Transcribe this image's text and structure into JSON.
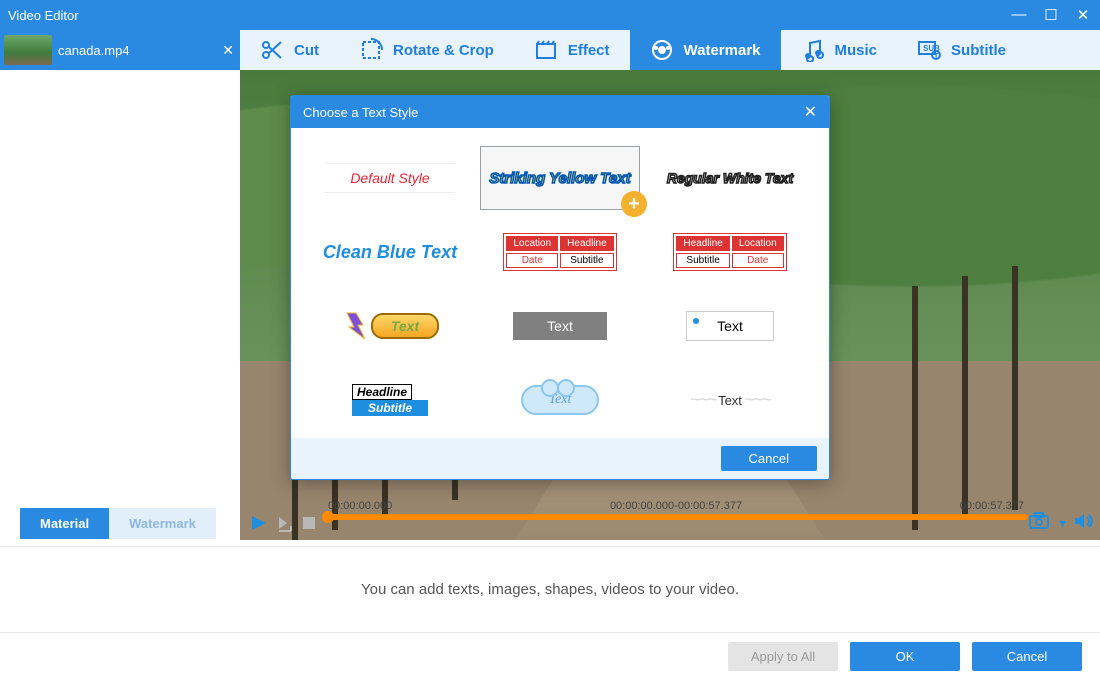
{
  "app": {
    "title": "Video Editor"
  },
  "file": {
    "name": "canada.mp4"
  },
  "toolbar": {
    "cut": "Cut",
    "rotate": "Rotate & Crop",
    "effect": "Effect",
    "watermark": "Watermark",
    "music": "Music",
    "subtitle": "Subtitle",
    "active": "watermark"
  },
  "modal": {
    "title": "Choose a Text Style",
    "cancel": "Cancel",
    "styles": {
      "default": "Default Style",
      "striking_yellow": "Striking Yellow Text",
      "regular_white": "Regular White Text",
      "clean_blue": "Clean Blue Text",
      "red1": {
        "location": "Location",
        "headline": "Headline",
        "date": "Date",
        "subtitle": "Subtitle"
      },
      "red2": {
        "headline": "Headline",
        "location": "Location",
        "subtitle": "Subtitle",
        "date": "Date"
      },
      "gold": "Text",
      "gray": "Text",
      "plain": "Text",
      "hlsub": {
        "headline": "Headline",
        "subtitle": "Subtitle"
      },
      "cloud": "Text",
      "wreath": "Text"
    },
    "selected": "striking_yellow"
  },
  "lower_tabs": {
    "material": "Material",
    "watermark": "Watermark",
    "active": "material"
  },
  "playback": {
    "start": "00:00:00.000",
    "range": "00:00:00.000-00:00:57.377",
    "end": "00:00:57.377"
  },
  "info": {
    "hint": "You can add texts, images, shapes, videos to your video."
  },
  "bottom": {
    "apply_all": "Apply to All",
    "ok": "OK",
    "cancel": "Cancel"
  }
}
